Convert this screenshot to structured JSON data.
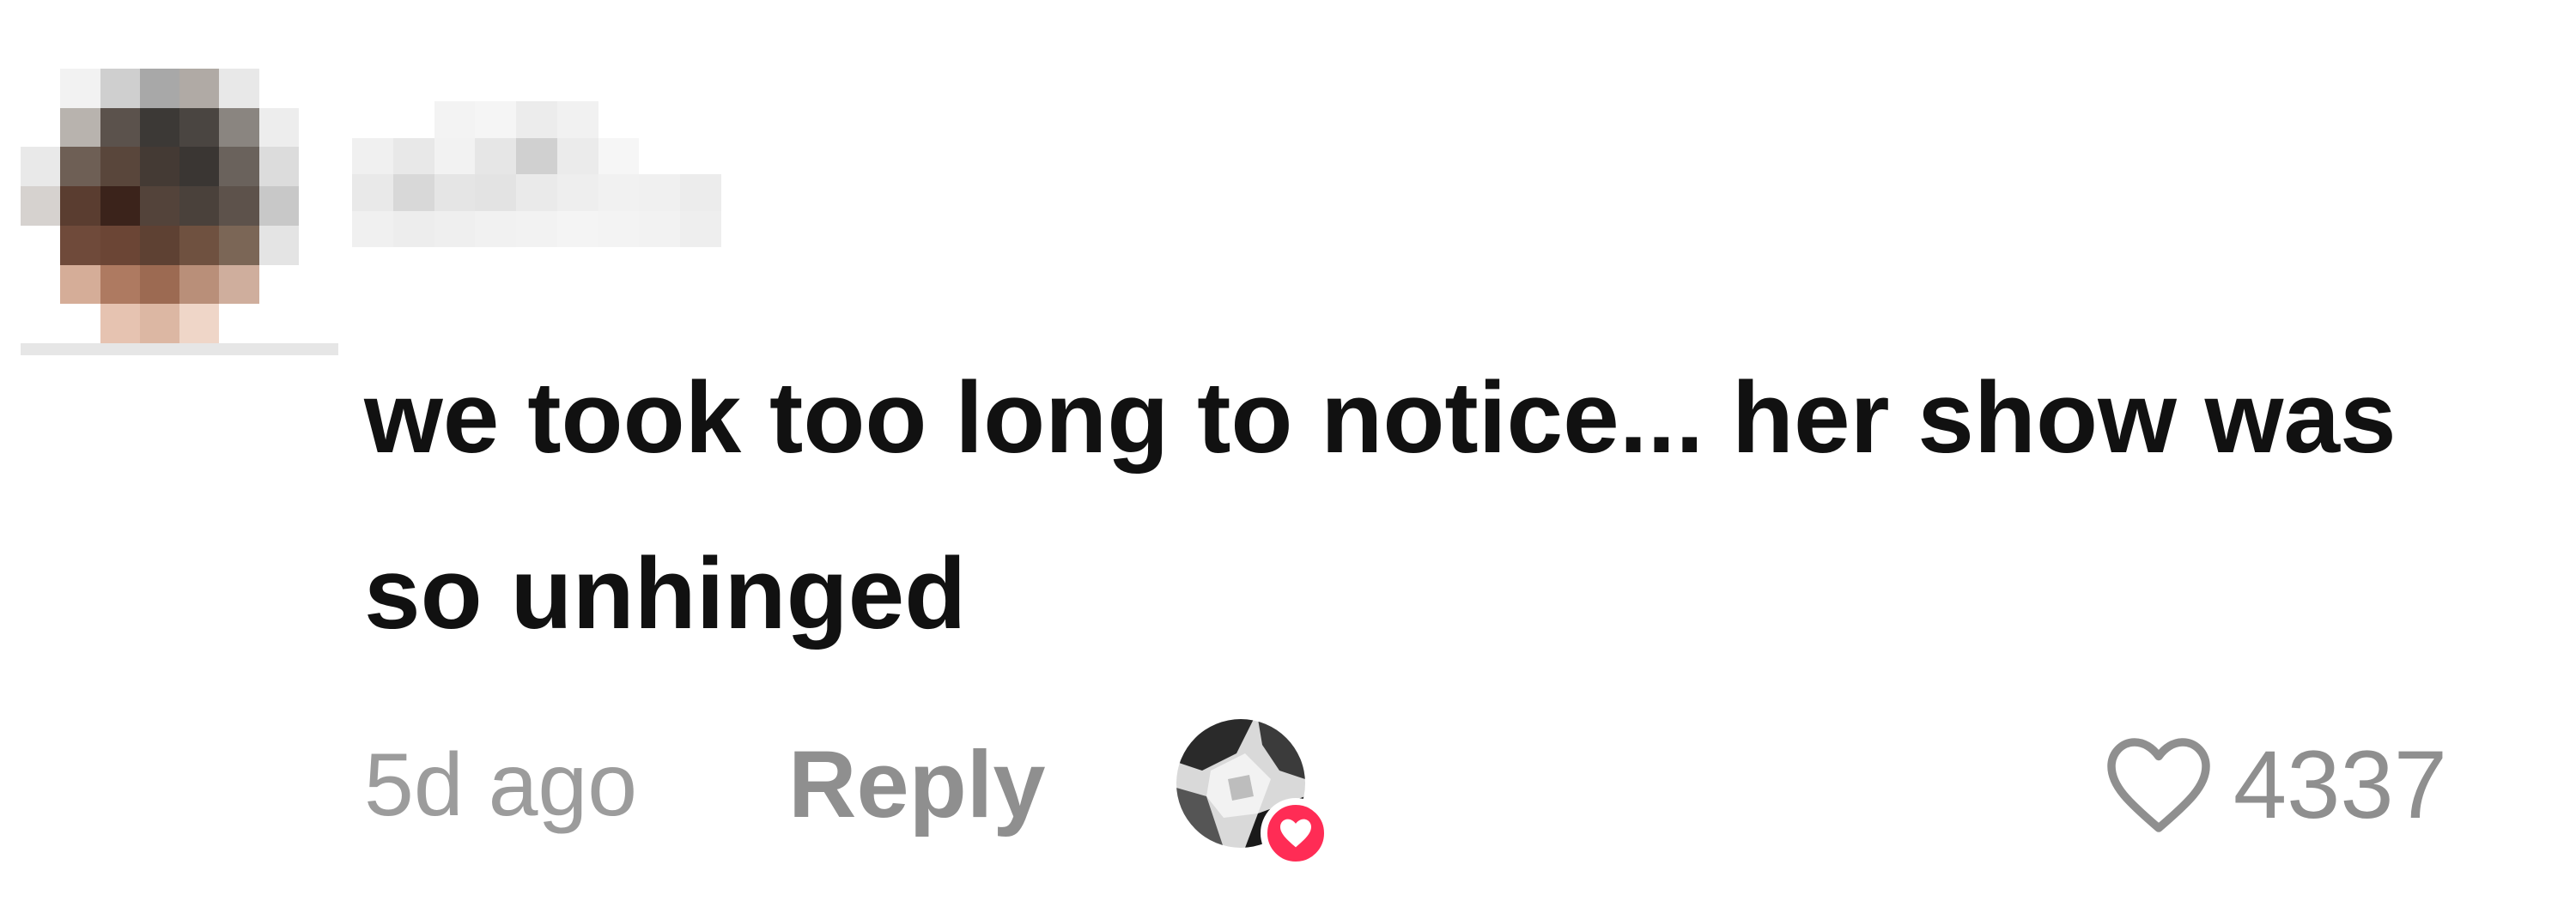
{
  "comment": {
    "text": "we took too long to notice... her show was so unhinged",
    "time_ago": "5d ago",
    "reply_label": "Reply",
    "like_count": "4337",
    "liked_by_creator": true
  },
  "icons": {
    "like": "heart-outline-icon",
    "creator_badge": "heart-filled-icon"
  },
  "colors": {
    "text": "#111111",
    "meta": "#8f8f8f",
    "badge": "#ff2c55"
  }
}
